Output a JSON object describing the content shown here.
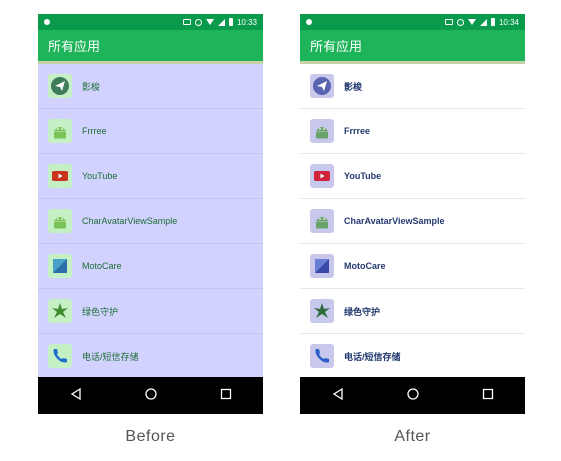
{
  "before": {
    "status_time": "10:33",
    "appbar_title": "所有应用",
    "apps": [
      {
        "label": "影梭",
        "icon": "paper-plane-icon"
      },
      {
        "label": "Frrree",
        "icon": "android-icon"
      },
      {
        "label": "YouTube",
        "icon": "youtube-icon"
      },
      {
        "label": "CharAvatarViewSample",
        "icon": "android-icon"
      },
      {
        "label": "MotoCare",
        "icon": "motocare-icon"
      },
      {
        "label": "绿色守护",
        "icon": "leaf-icon"
      },
      {
        "label": "电话/短信存储",
        "icon": "phone-icon"
      }
    ],
    "caption": "Before"
  },
  "after": {
    "status_time": "10:34",
    "appbar_title": "所有应用",
    "apps": [
      {
        "label": "影梭",
        "icon": "paper-plane-icon"
      },
      {
        "label": "Frrree",
        "icon": "android-icon"
      },
      {
        "label": "YouTube",
        "icon": "youtube-icon"
      },
      {
        "label": "CharAvatarViewSample",
        "icon": "android-icon"
      },
      {
        "label": "MotoCare",
        "icon": "motocare-icon"
      },
      {
        "label": "绿色守护",
        "icon": "leaf-icon"
      },
      {
        "label": "电话/短信存储",
        "icon": "phone-icon"
      }
    ],
    "caption": "After"
  },
  "colors": {
    "statusbar": "#0a9a4c",
    "appbar": "#1eb45a",
    "list_before_bg": "#d2d2ff",
    "list_after_bg": "#ffffff",
    "navbar": "#000000"
  }
}
